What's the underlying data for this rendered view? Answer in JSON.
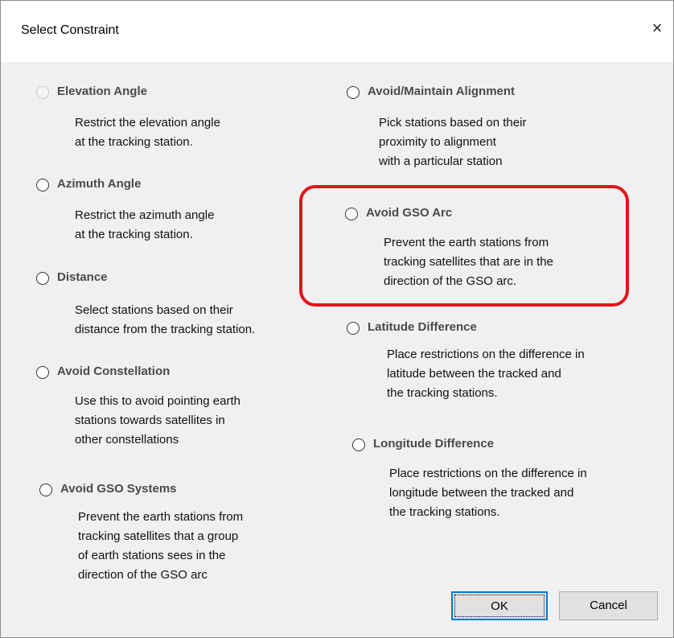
{
  "dialog": {
    "title": "Select Constraint",
    "close_glyph": "×"
  },
  "options": [
    {
      "title": "Elevation Angle",
      "desc": [
        "Restrict the elevation angle",
        "at the tracking station."
      ],
      "enabled": false
    },
    {
      "title": "Azimuth Angle",
      "desc": [
        "Restrict the azimuth angle",
        "at the tracking station."
      ],
      "enabled": true
    },
    {
      "title": "Distance",
      "desc": [
        "Select stations based on their",
        "distance from the tracking station."
      ],
      "enabled": true
    },
    {
      "title": "Avoid Constellation",
      "desc": [
        "Use this to avoid pointing earth",
        "stations towards satellites in",
        "other constellations"
      ],
      "enabled": true
    },
    {
      "title": "Avoid GSO Systems",
      "desc": [
        "Prevent the earth stations from",
        "tracking satellites that a group",
        "of earth stations sees in the",
        "direction of the GSO arc"
      ],
      "enabled": true
    },
    {
      "title": "Avoid/Maintain Alignment",
      "desc": [
        "Pick stations based on their",
        "proximity to alignment",
        "with a particular station"
      ],
      "enabled": true
    },
    {
      "title": "Avoid GSO Arc",
      "desc": [
        "Prevent the earth stations from",
        "tracking satellites that are in the",
        "direction of the GSO arc."
      ],
      "enabled": true
    },
    {
      "title": "Latitude Difference",
      "desc": [
        "Place restrictions on the difference in",
        "latitude between the tracked and",
        "the tracking stations."
      ],
      "enabled": true
    },
    {
      "title": "Longitude Difference",
      "desc": [
        "Place restrictions on the difference in",
        "longitude between the tracked and",
        "the tracking stations."
      ],
      "enabled": true
    }
  ],
  "buttons": {
    "ok": "OK",
    "cancel": "Cancel"
  },
  "colors": {
    "highlight": "#e3141c",
    "focus_border": "#0078d7",
    "dialog_bg": "#f0f0f0"
  }
}
